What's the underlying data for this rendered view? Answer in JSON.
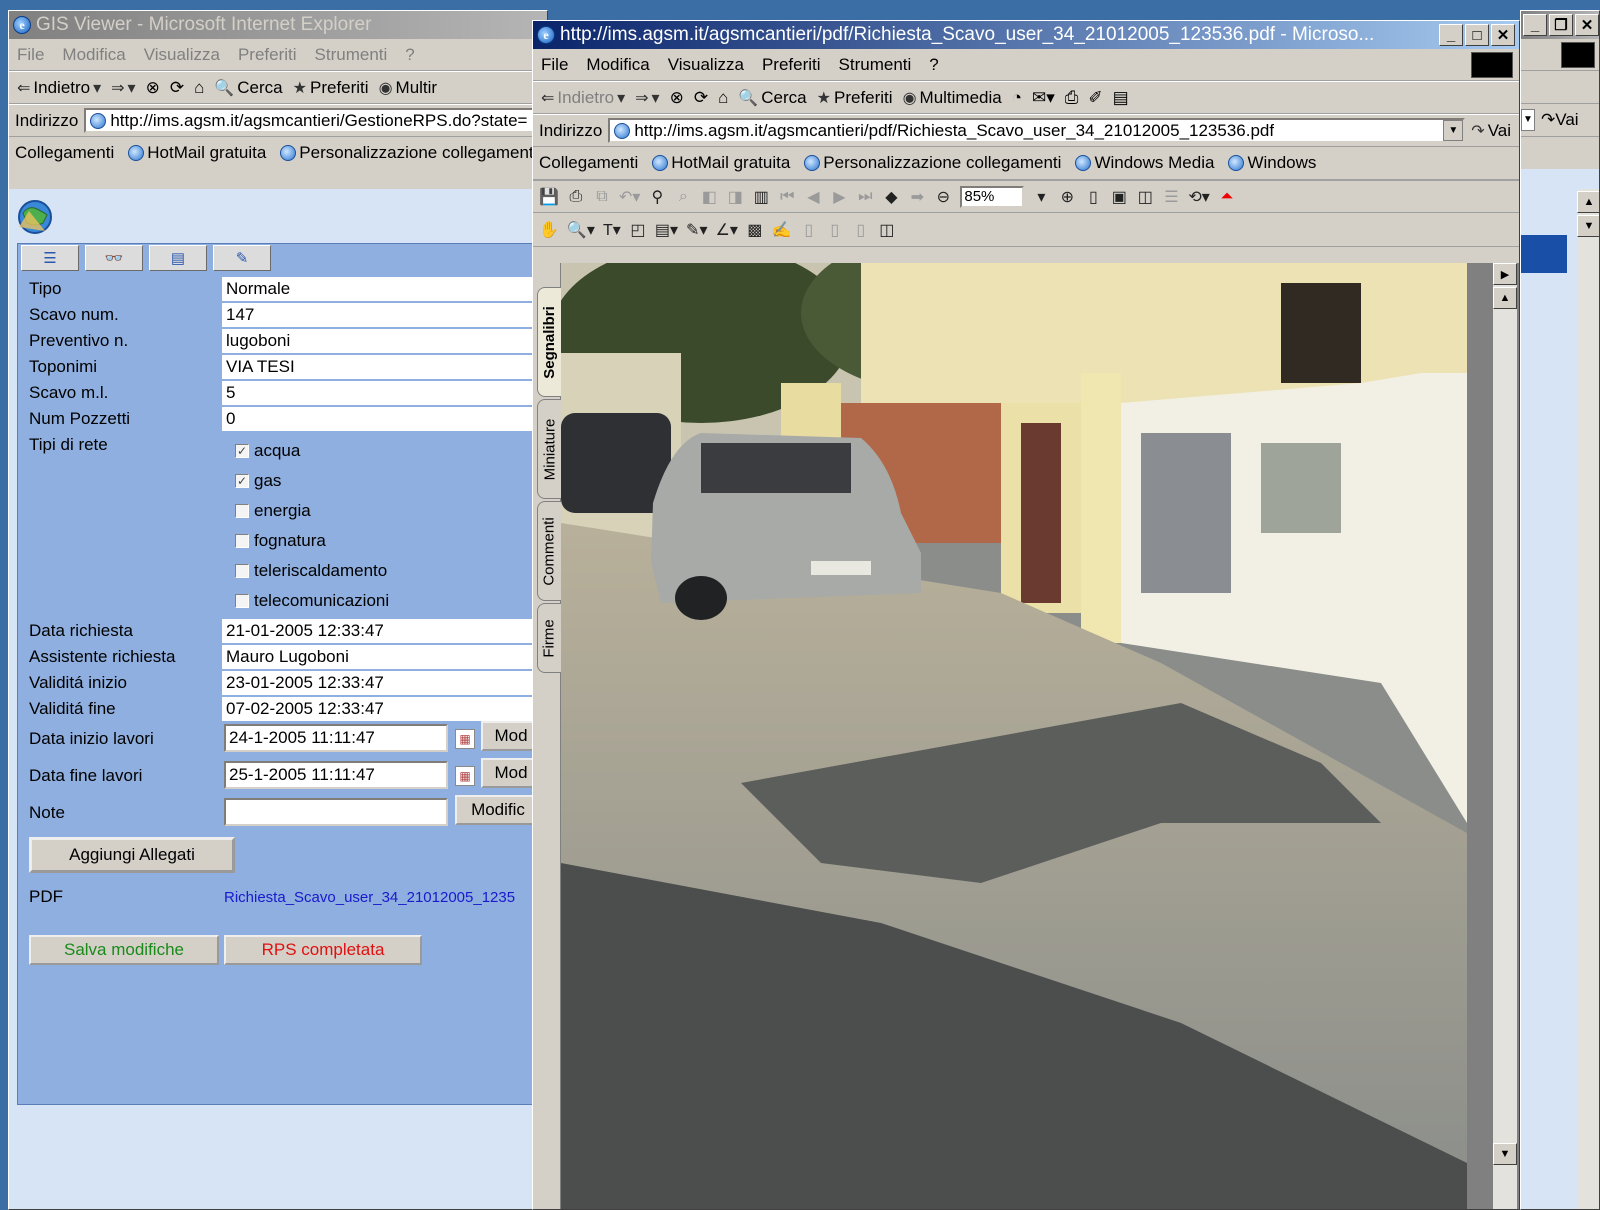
{
  "back_window": {
    "title": "GIS Viewer - Microsoft Internet Explorer",
    "menu": [
      "File",
      "Modifica",
      "Visualizza",
      "Preferiti",
      "Strumenti",
      "?"
    ],
    "toolbar": {
      "back": "Indietro",
      "search": "Cerca",
      "favorites": "Preferiti",
      "media": "Multir"
    },
    "address": {
      "label": "Indirizzo",
      "url": "http://ims.agsm.it/agsmcantieri/GestioneRPS.do?state=",
      "go": "Vai"
    },
    "links": {
      "label": "Collegamenti",
      "items": [
        "HotMail gratuita",
        "Personalizzazione collegament"
      ]
    }
  },
  "form": {
    "fields": [
      {
        "label": "Tipo",
        "value": "Normale"
      },
      {
        "label": "Scavo num.",
        "value": "147"
      },
      {
        "label": "Preventivo n.",
        "value": "lugoboni"
      },
      {
        "label": "Toponimi",
        "value": "VIA TESI"
      },
      {
        "label": "Scavo m.l.",
        "value": "5"
      },
      {
        "label": "Num Pozzetti",
        "value": "0"
      }
    ],
    "network_label": "Tipi di rete",
    "networks": [
      {
        "label": "acqua",
        "checked": true
      },
      {
        "label": "gas",
        "checked": true
      },
      {
        "label": "energia",
        "checked": false
      },
      {
        "label": "fognatura",
        "checked": false
      },
      {
        "label": "teleriscaldamento",
        "checked": false
      },
      {
        "label": "telecomunicazioni",
        "checked": false
      }
    ],
    "dates": [
      {
        "label": "Data richiesta",
        "value": "21-01-2005 12:33:47"
      },
      {
        "label": "Assistente richiesta",
        "value": "Mauro Lugoboni"
      },
      {
        "label": "Validitá inizio",
        "value": "23-01-2005 12:33:47"
      },
      {
        "label": "Validitá fine",
        "value": "07-02-2005 12:33:47"
      }
    ],
    "work_start": {
      "label": "Data inizio lavori",
      "value": "24-1-2005 11:11:47",
      "button": "Mod"
    },
    "work_end": {
      "label": "Data fine lavori",
      "value": "25-1-2005 11:11:47",
      "button": "Mod"
    },
    "note": {
      "label": "Note",
      "value": "",
      "button": "Modific"
    },
    "attach_button": "Aggiungi Allegati",
    "pdf_label": "PDF",
    "pdf_link": "Richiesta_Scavo_user_34_21012005_1235",
    "save_button": "Salva modifiche",
    "complete_button": "RPS completata",
    "save_color": "#1a8a1a",
    "complete_color": "#e01010"
  },
  "front_window": {
    "title": "http://ims.agsm.it/agsmcantieri/pdf/Richiesta_Scavo_user_34_21012005_123536.pdf - Microso...",
    "menu": [
      "File",
      "Modifica",
      "Visualizza",
      "Preferiti",
      "Strumenti",
      "?"
    ],
    "toolbar": {
      "back": "Indietro",
      "search": "Cerca",
      "favorites": "Preferiti",
      "media": "Multimedia"
    },
    "address": {
      "label": "Indirizzo",
      "url": "http://ims.agsm.it/agsmcantieri/pdf/Richiesta_Scavo_user_34_21012005_123536.pdf",
      "go": "Vai"
    },
    "links": {
      "label": "Collegamenti",
      "items": [
        "HotMail gratuita",
        "Personalizzazione collegamenti",
        "Windows Media",
        "Windows"
      ]
    },
    "zoom": "85%",
    "side_tabs": [
      "Segnalibri",
      "Miniature",
      "Commenti",
      "Firme"
    ]
  },
  "right_window": {
    "go": "Vai"
  },
  "colors": {
    "titlebar_active": "#0a246a",
    "panel_bg": "#8eafdf",
    "link": "#1a1acc"
  }
}
